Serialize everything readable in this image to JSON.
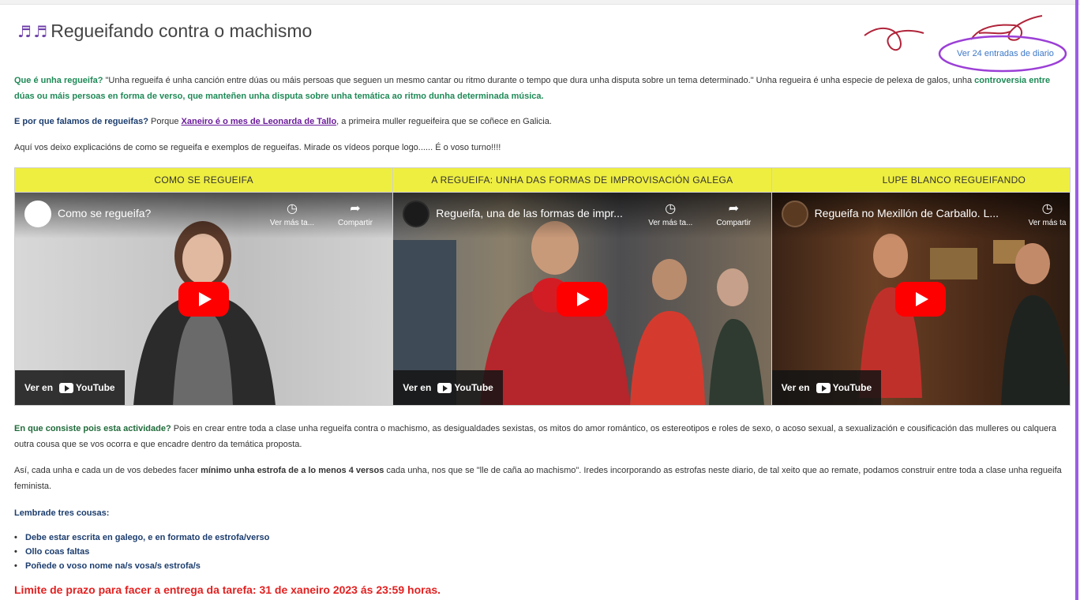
{
  "page": {
    "title": "Regueifando contra o machismo",
    "title_icon": "music-notes-icon",
    "diary_link": "Ver 24 entradas de diario"
  },
  "intro": {
    "q1_bold": "Que é unha regueifa?",
    "q1_text": " \"Unha regueifa é unha canción entre dúas ou máis persoas que seguen un mesmo cantar ou ritmo durante o tempo que dura unha disputa sobre un tema determinado.\" Unha regueira é unha especie de pelexa de galos, unha ",
    "q1_bold2": "controversia entre dúas ou máis persoas en forma de verso, que manteñen unha disputa sobre unha temática ao ritmo dunha determinada música.",
    "q2_bold": "E por que falamos de regueifas?",
    "q2_text": " Porque ",
    "q2_link": "Xaneiro é o mes de Leonarda de Tallo",
    "q2_text2": ", a primeira muller regueifeira que se coñece en Galicia.",
    "q3_text": "Aquí vos deixo explicacións de como se regueifa e exemplos de regueifas. Mirade os vídeos porque logo...... É o voso turno!!!!"
  },
  "videos": [
    {
      "header": "COMO SE REGUEIFA",
      "title": "Como se regueifa?",
      "watch_later": "Ver más ta...",
      "share": "Compartir",
      "watch_on": "Ver en",
      "platform": "YouTube"
    },
    {
      "header": "A REGUEIFA: UNHA DAS FORMAS DE IMPROVISACIÓN GALEGA",
      "title": "Regueifa, una de las formas de impr...",
      "watch_later": "Ver más ta...",
      "share": "Compartir",
      "watch_on": "Ver en",
      "platform": "YouTube"
    },
    {
      "header": "LUPE BLANCO REGUEIFANDO",
      "title": "Regueifa no Mexillón de Carballo. L...",
      "watch_later": "Ver más ta",
      "share": "",
      "watch_on": "Ver en",
      "platform": "YouTube"
    }
  ],
  "activity": {
    "q_bold": "En que consiste pois esta actividade?",
    "q_text": " Pois en crear entre toda a clase unha regueifa contra o machismo, as desigualdades sexistas, os mitos do amor romántico, os estereotipos e roles de sexo, o acoso sexual, a sexualización e cousificación das mulleres ou calquera outra cousa que se vos ocorra e que encadre dentro da temática proposta.",
    "p2_a": "Así, cada unha e cada un de vos debedes facer ",
    "p2_bold": "mínimo unha estrofa de a lo menos 4 versos",
    "p2_b": " cada unha, nos que se \"lle de caña ao machismo\". Iredes incorporando as estrofas neste diario, de tal xeito que ao remate, podamos construir entre toda a clase unha regueifa feminista.",
    "remember": "Lembrade tres cousas:",
    "items": [
      "Debe estar escrita en galego, e en formato de estrofa/verso",
      "Ollo coas faltas",
      "Poñede o voso nome na/s vosa/s estrofa/s"
    ],
    "deadline": "Limite de prazo para facer a entrega da tarefa: 31 de xaneiro 2023 ás 23:59 horas."
  },
  "colors": {
    "header_yellow": "#eeee41",
    "green": "#1f8a57",
    "navy": "#1c3d6e",
    "red": "#e32020",
    "purple": "#9b5de5",
    "link_blue": "#3c78c9"
  }
}
